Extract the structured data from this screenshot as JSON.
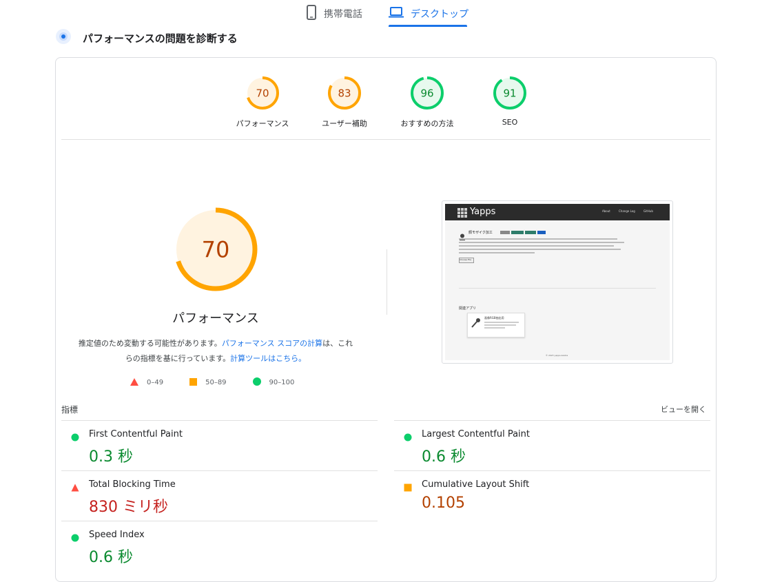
{
  "tabs": [
    {
      "label": "携帯電話",
      "icon": "mobile-phone-icon",
      "active": false
    },
    {
      "label": "デスクトップ",
      "icon": "laptop-icon",
      "active": true
    }
  ],
  "section": {
    "title": "パフォーマンスの問題を診断する",
    "icon": "diagnose-icon"
  },
  "colors": {
    "good": "#0cce6b",
    "average": "#ffa400",
    "poor": "#ff4e42",
    "accent": "#1a73e8"
  },
  "categories": [
    {
      "label": "パフォーマンス",
      "score": 70,
      "rating": "average"
    },
    {
      "label": "ユーザー補助",
      "score": 83,
      "rating": "average"
    },
    {
      "label": "おすすめの方法",
      "score": 96,
      "rating": "good"
    },
    {
      "label": "SEO",
      "score": 91,
      "rating": "good"
    }
  ],
  "main": {
    "score": 70,
    "title": "パフォーマンス",
    "desc_pre": "推定値のため変動する可能性があります。",
    "desc_link1": "パフォーマンス スコアの計算",
    "desc_mid": "は、これらの指標を基に行っています。",
    "desc_link2": "計算ツールはこちら。"
  },
  "legend": [
    {
      "range": "0–49",
      "shape": "triangle"
    },
    {
      "range": "50–89",
      "shape": "square"
    },
    {
      "range": "90–100",
      "shape": "circle"
    }
  ],
  "screenshot": {
    "brand": "Yapps",
    "nav": [
      "About",
      "Change Log",
      "GitHub"
    ],
    "heading": "顔モザイク加工",
    "button": "Choose File",
    "related": "関連アプリ",
    "card_title": "画像RGB抽出用",
    "footer": "© 2023 yapps-kaisha"
  },
  "metrics_header": {
    "left": "指標",
    "right": "ビューを開く"
  },
  "metrics": [
    {
      "name": "First Contentful Paint",
      "value": "0.3 秒",
      "rating": "good"
    },
    {
      "name": "Largest Contentful Paint",
      "value": "0.6 秒",
      "rating": "good"
    },
    {
      "name": "Total Blocking Time",
      "value": "830 ミリ秒",
      "rating": "poor"
    },
    {
      "name": "Cumulative Layout Shift",
      "value": "0.105",
      "rating": "average"
    },
    {
      "name": "Speed Index",
      "value": "0.6 秒",
      "rating": "good"
    }
  ]
}
